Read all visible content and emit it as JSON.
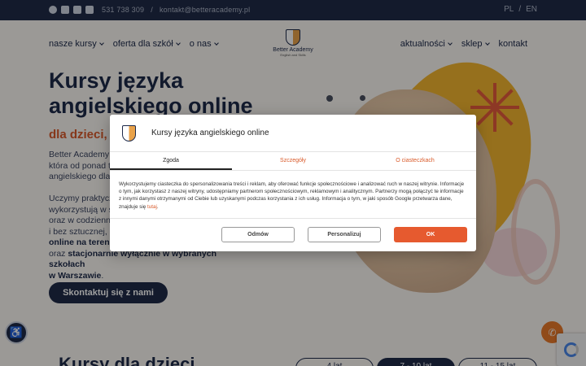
{
  "topbar": {
    "phone": "531 738 309",
    "separator": "/",
    "email": "kontakt@betteracademy.pl",
    "lang_pl": "PL",
    "lang_sep": "/",
    "lang_en": "EN"
  },
  "nav": {
    "left": [
      "nasze kursy",
      "oferta dla szkół",
      "o nas"
    ],
    "right": [
      "aktualności",
      "sklep",
      "kontakt"
    ]
  },
  "logo": {
    "brand": "Better Academy",
    "sub": "English and Skills"
  },
  "hero": {
    "title_line1": "Kursy języka",
    "title_line2": "angielskiego online",
    "subtitle": "dla dzieci, m",
    "p1_l1": "Better Academy",
    "p1_l2": "która od ponad t",
    "p1_l3": "angielskiego dla",
    "p2_l1": "Uczymy praktycz",
    "p2_l2": "wykorzystują w s",
    "p2_l3": "oraz w codzienny",
    "p2_l4": "i bez sztucznej, s",
    "p2_l5": "online na terenie",
    "p2_l6a": "oraz ",
    "p2_l6b": "stacjonarnie wyłącznie w wybranych szkołach",
    "p2_l7": "w Warszawie",
    "p2_l7_end": ".",
    "cta": "Skontaktuj się z nami"
  },
  "section": {
    "title": "Kursy dla dzieci",
    "tabs": [
      "4 lat",
      "7 - 10 lat",
      "11 - 15 lat"
    ]
  },
  "dialog": {
    "title": "Kursy języka angielskiego online",
    "tabs": [
      "Zgoda",
      "Szczegóły",
      "O ciasteczkach"
    ],
    "text": "Wykorzystujemy ciasteczka do spersonalizowania treści i reklam, aby oferować funkcje społecznościowe i analizować ruch w naszej witrynie. Informacje o tym, jak korzystasz z naszej witryny, udostępniamy partnerom społecznościowym, reklamowym i analitycznym. Partnerzy mogą połączyć te informacje z innymi danymi otrzymanymi od Ciebie lub uzyskanymi podczas korzystania z ich usług. Informacja o tym, w jaki sposób Google przetwarza dane, znajduje się ",
    "link": "tutaj",
    "text_end": ".",
    "btn_deny": "Odmów",
    "btn_custom": "Personalizuj",
    "btn_ok": "OK"
  },
  "icons": {
    "social": [
      "facebook-icon",
      "instagram-icon",
      "youtube-icon",
      "tiktok-icon"
    ],
    "accessibility": "accessibility-icon",
    "phone": "phone-icon"
  },
  "colors": {
    "navy": "#1f2b48",
    "accent": "#e65a2f",
    "yellow": "#f2b530"
  }
}
